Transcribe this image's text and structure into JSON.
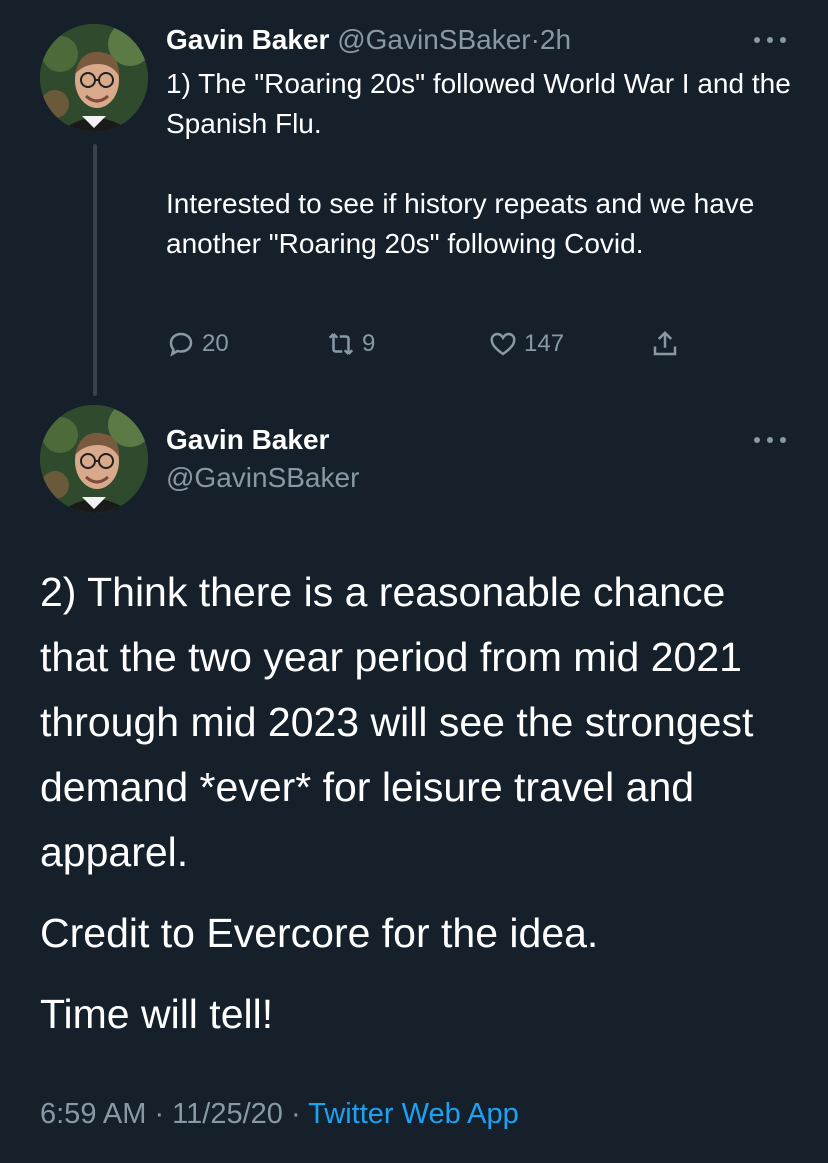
{
  "colors": {
    "background": "#15202b",
    "text": "#ffffff",
    "muted": "#8899a6",
    "link": "#1da1f2",
    "thread_line": "#38444d"
  },
  "tweet1": {
    "author_name": "Gavin Baker",
    "handle": "@GavinSBaker",
    "separator": "·",
    "time": "2h",
    "more_icon": "more-horizontal-icon",
    "text_line1": "1) The \"Roaring 20s\" followed World War I and the Spanish Flu.",
    "text_line2": "Interested to see if history repeats and we have another \"Roaring 20s\" following Covid.",
    "actions": {
      "reply_count": "20",
      "retweet_count": "9",
      "like_count": "147",
      "reply_icon": "reply-icon",
      "retweet_icon": "retweet-icon",
      "like_icon": "heart-icon",
      "share_icon": "share-icon"
    }
  },
  "tweet2": {
    "author_name": "Gavin Baker",
    "handle": "@GavinSBaker",
    "more_icon": "more-horizontal-icon",
    "paragraph1": "2) Think there is a reasonable chance that the two year period from mid 2021 through mid 2023 will see the strongest demand *ever* for leisure travel and apparel.",
    "paragraph2": "Credit to Evercore for the idea.",
    "paragraph3": "Time will tell!",
    "timestamp": "6:59 AM · 11/25/20 · ",
    "source": "Twitter Web App"
  }
}
